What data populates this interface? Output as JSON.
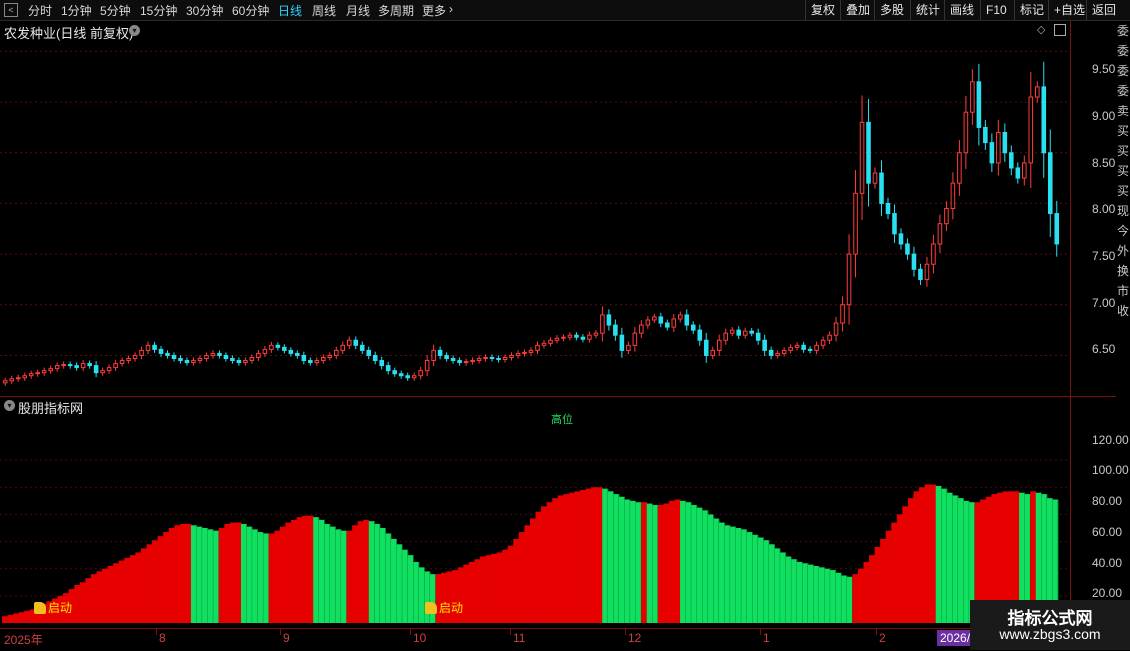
{
  "toolbar": {
    "periods": [
      "分时",
      "1分钟",
      "5分钟",
      "15分钟",
      "30分钟",
      "60分钟",
      "日线",
      "周线",
      "月线",
      "多周期",
      "更多"
    ],
    "active_period": "日线",
    "buttons": [
      "复权",
      "叠加",
      "多股",
      "统计",
      "画线",
      "F10",
      "标记",
      "+自选",
      "返回"
    ]
  },
  "main_panel": {
    "title": "农发种业(日线 前复权)",
    "price_axis": [
      "9.50",
      "9.00",
      "8.50",
      "8.00",
      "7.50",
      "7.00",
      "6.50"
    ]
  },
  "indicator_panel": {
    "title": "股朋指标网",
    "mid_label": "高位",
    "axis": [
      "120.00",
      "100.00",
      "80.00",
      "60.00",
      "40.00",
      "20.00"
    ],
    "launch_label": "启动"
  },
  "date_axis": [
    "2025年",
    "8",
    "9",
    "10",
    "11",
    "12",
    "1",
    "2"
  ],
  "date_highlight": "2026/",
  "watermark": {
    "line1": "指标公式网",
    "line2": "www.zbgs3.com"
  },
  "colors": {
    "up": "#ff3c3c",
    "down": "#28e0f0",
    "red_bar": "#e60000",
    "green_bar": "#10e060"
  },
  "chart_data": [
    {
      "type": "candlestick",
      "title": "农发种业(日线 前复权)",
      "ylim": [
        6.1,
        9.8
      ],
      "close_series": [
        6.25,
        6.27,
        6.28,
        6.3,
        6.32,
        6.33,
        6.35,
        6.37,
        6.4,
        6.41,
        6.4,
        6.38,
        6.42,
        6.4,
        6.33,
        6.35,
        6.38,
        6.42,
        6.45,
        6.47,
        6.5,
        6.55,
        6.6,
        6.56,
        6.52,
        6.5,
        6.47,
        6.45,
        6.43,
        6.45,
        6.47,
        6.5,
        6.52,
        6.5,
        6.47,
        6.45,
        6.43,
        6.45,
        6.48,
        6.52,
        6.56,
        6.6,
        6.58,
        6.55,
        6.52,
        6.5,
        6.45,
        6.43,
        6.45,
        6.48,
        6.5,
        6.55,
        6.6,
        6.65,
        6.6,
        6.55,
        6.5,
        6.45,
        6.4,
        6.35,
        6.32,
        6.3,
        6.28,
        6.3,
        6.35,
        6.45,
        6.55,
        6.5,
        6.47,
        6.45,
        6.43,
        6.44,
        6.45,
        6.47,
        6.48,
        6.47,
        6.46,
        6.48,
        6.5,
        6.52,
        6.53,
        6.55,
        6.6,
        6.62,
        6.65,
        6.67,
        6.68,
        6.7,
        6.68,
        6.66,
        6.7,
        6.72,
        6.9,
        6.8,
        6.7,
        6.55,
        6.6,
        6.72,
        6.8,
        6.85,
        6.88,
        6.82,
        6.78,
        6.86,
        6.9,
        6.8,
        6.75,
        6.65,
        6.5,
        6.55,
        6.65,
        6.72,
        6.75,
        6.7,
        6.74,
        6.72,
        6.65,
        6.55,
        6.5,
        6.52,
        6.55,
        6.58,
        6.6,
        6.56,
        6.55,
        6.6,
        6.65,
        6.7,
        6.82,
        7.0,
        7.5,
        8.1,
        8.8,
        8.2,
        8.3,
        8.0,
        7.9,
        7.7,
        7.6,
        7.5,
        7.35,
        7.25,
        7.4,
        7.6,
        7.8,
        7.95,
        8.2,
        8.5,
        8.9,
        9.2,
        8.75,
        8.6,
        8.4,
        8.7,
        8.5,
        8.35,
        8.25,
        8.4,
        9.05,
        9.15,
        8.5,
        7.9,
        7.6
      ]
    },
    {
      "type": "bar",
      "title": "股朋指标网",
      "ylim": [
        0,
        140
      ],
      "red_green_pattern": "red while rising, green while falling",
      "values": [
        5,
        6,
        7,
        8,
        9,
        10,
        12,
        14,
        16,
        18,
        20,
        22,
        25,
        28,
        30,
        33,
        36,
        38,
        40,
        42,
        44,
        46,
        48,
        50,
        52,
        55,
        58,
        61,
        64,
        67,
        70,
        72,
        73,
        73,
        72,
        71,
        70,
        69,
        68,
        70,
        73,
        74,
        74,
        73,
        71,
        69,
        67,
        66,
        66,
        68,
        71,
        74,
        76,
        78,
        79,
        79,
        78,
        76,
        73,
        71,
        69,
        68,
        68,
        72,
        75,
        76,
        75,
        73,
        70,
        66,
        62,
        58,
        54,
        50,
        45,
        41,
        38,
        36,
        36,
        37,
        38,
        39,
        41,
        43,
        45,
        47,
        49,
        50,
        51,
        52,
        54,
        57,
        62,
        67,
        72,
        77,
        82,
        86,
        89,
        92,
        94,
        95,
        96,
        97,
        98,
        99,
        100,
        100,
        99,
        97,
        95,
        93,
        91,
        90,
        89,
        89,
        88,
        87,
        87,
        88,
        90,
        91,
        90,
        89,
        87,
        85,
        83,
        80,
        77,
        74,
        72,
        71,
        70,
        69,
        67,
        65,
        63,
        61,
        58,
        55,
        52,
        49,
        47,
        45,
        44,
        43,
        42,
        41,
        40,
        39,
        37,
        35,
        34,
        36,
        40,
        45,
        50,
        56,
        62,
        68,
        74,
        80,
        86,
        92,
        97,
        100,
        102,
        102,
        101,
        99,
        96,
        94,
        92,
        90,
        89,
        89,
        91,
        93,
        95,
        96,
        97,
        97,
        97,
        96,
        95,
        97,
        96,
        95,
        92,
        91
      ]
    }
  ]
}
